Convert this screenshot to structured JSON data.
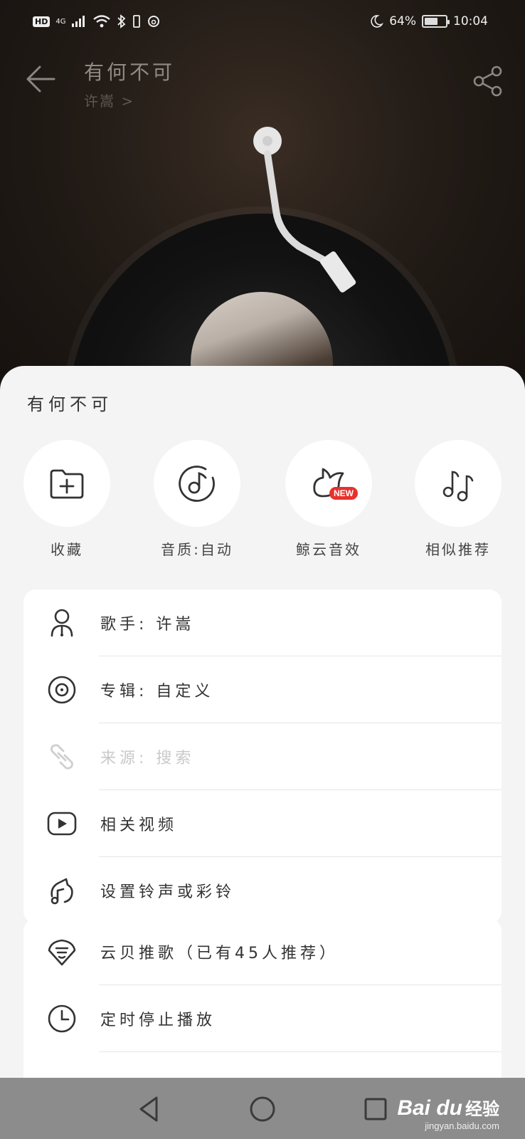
{
  "status_bar": {
    "hd": "HD",
    "network": "4G",
    "battery_percent": "64%",
    "battery_level": 0.64,
    "time": "10:04"
  },
  "header": {
    "song_title": "有何不可",
    "artist": "许嵩 >"
  },
  "sheet": {
    "title": "有何不可",
    "quick_actions": [
      {
        "label": "收藏",
        "icon": "folder-add-icon"
      },
      {
        "label": "音质:自动",
        "icon": "music-disc-icon"
      },
      {
        "label": "鲸云音效",
        "icon": "whale-icon",
        "badge": "NEW"
      },
      {
        "label": "相似推荐",
        "icon": "music-notes-icon"
      }
    ],
    "menu_group_1": [
      {
        "label": "歌手: 许嵩",
        "icon": "singer-icon",
        "disabled": false
      },
      {
        "label": "专辑: 自定义",
        "icon": "album-icon",
        "disabled": false
      },
      {
        "label": "来源: 搜索",
        "icon": "link-icon",
        "disabled": true
      },
      {
        "label": "相关视频",
        "icon": "video-play-icon",
        "disabled": false
      },
      {
        "label": "设置铃声或彩铃",
        "icon": "ringtone-icon",
        "disabled": false
      }
    ],
    "menu_group_2": [
      {
        "label": "云贝推歌（已有45人推荐）",
        "icon": "yunbei-icon",
        "disabled": false
      },
      {
        "label": "定时停止播放",
        "icon": "clock-icon",
        "disabled": false
      }
    ]
  },
  "nav_bar": {
    "watermark_logo": "Bai du",
    "watermark_text": "经验",
    "watermark_url": "jingyan.baidu.com"
  }
}
